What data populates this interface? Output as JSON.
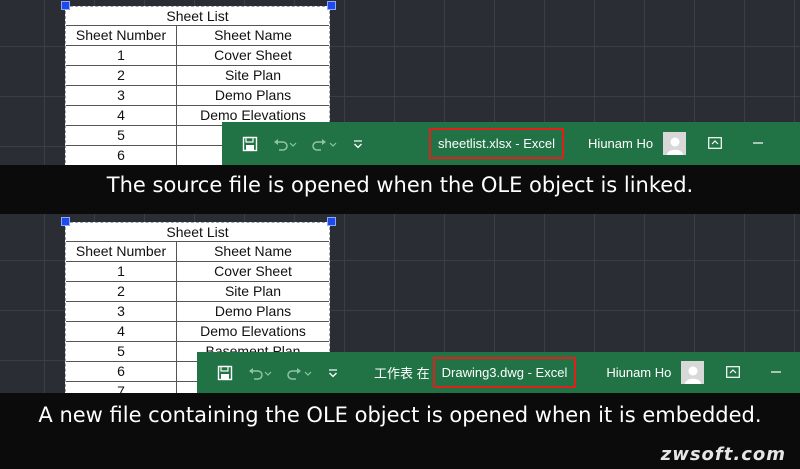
{
  "sheet_table": {
    "title": "Sheet List",
    "headers": [
      "Sheet Number",
      "Sheet Name"
    ],
    "rows": [
      [
        "1",
        "Cover Sheet"
      ],
      [
        "2",
        "Site Plan"
      ],
      [
        "3",
        "Demo Plans"
      ],
      [
        "4",
        "Demo Elevations"
      ],
      [
        "5",
        "Basement Plan"
      ],
      [
        "6",
        "Main Level Plan"
      ],
      [
        "7",
        ""
      ]
    ]
  },
  "linked_example": {
    "excel_title": "sheetlist.xlsx  -  Excel",
    "user_name": "Hiunam Ho",
    "caption": "The source file is opened when the OLE object is linked.",
    "visible_rows": {
      "r5_name": "Ba",
      "r6_name": "Main L"
    }
  },
  "embedded_example": {
    "title_prefix": "工作表 在",
    "excel_title": "Drawing3.dwg  -  Excel",
    "user_name": "Hiunam Ho",
    "caption": "A new file containing the OLE object is opened when it is embedded.",
    "visible_rows": {
      "r6_name": "Ma"
    }
  },
  "watermark": "zwsoft.com",
  "colors": {
    "excel_green": "#217346",
    "highlight_red": "#e0201c",
    "grip_blue": "#1d4ae8",
    "canvas_bg": "#2a2d33",
    "caption_bg": "#0b0b0b"
  },
  "icons": {
    "save": "save-icon",
    "undo": "undo-icon",
    "redo": "redo-icon",
    "customize": "customize-quick-access-icon",
    "avatar": "user-avatar-icon",
    "ribbon_options": "ribbon-display-options-icon"
  }
}
